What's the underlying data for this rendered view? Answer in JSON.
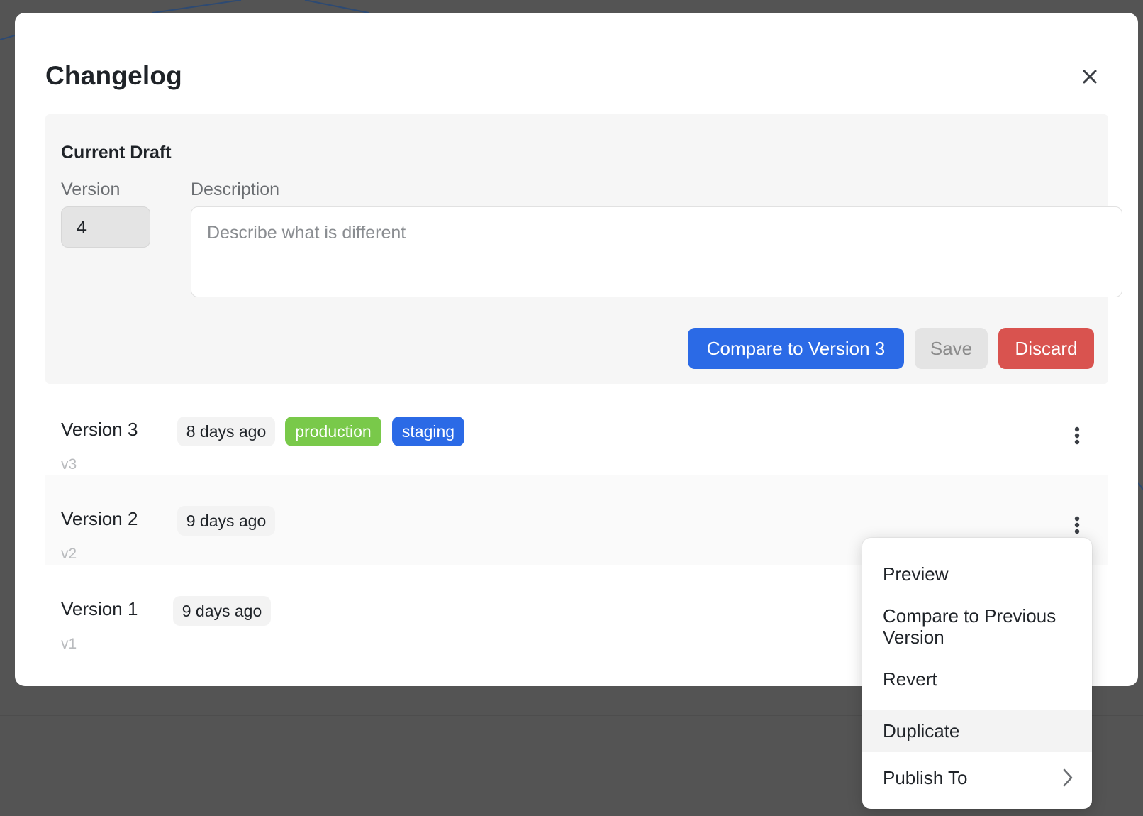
{
  "modal": {
    "title": "Changelog",
    "close_icon": "close-icon"
  },
  "draft": {
    "title": "Current Draft",
    "version_label": "Version",
    "version_value": "4",
    "description_label": "Description",
    "description_placeholder": "Describe what is different",
    "compare_label": "Compare to Version 3",
    "save_label": "Save",
    "discard_label": "Discard"
  },
  "versions": [
    {
      "name": "Version 3",
      "age": "8 days ago",
      "tags": [
        "production",
        "staging"
      ],
      "short": "v3",
      "menu_icon": "kebab-menu-icon"
    },
    {
      "name": "Version 2",
      "age": "9 days ago",
      "tags": [],
      "short": "v2",
      "menu_icon": "kebab-menu-icon"
    },
    {
      "name": "Version 1",
      "age": "9 days ago",
      "tags": [],
      "short": "v1"
    }
  ],
  "context_menu": {
    "items": [
      {
        "label": "Preview"
      },
      {
        "label": "Compare to Previous Version"
      },
      {
        "label": "Revert"
      },
      {
        "label": "Duplicate",
        "hovered": true
      },
      {
        "label": "Publish To",
        "submenu_icon": "chevron-right-icon"
      }
    ]
  },
  "colors": {
    "primary": "#2b6ae6",
    "danger": "#d9534f",
    "production_tag": "#79c94a",
    "staging_tag": "#2b6ae6",
    "overlay": "#545454"
  }
}
